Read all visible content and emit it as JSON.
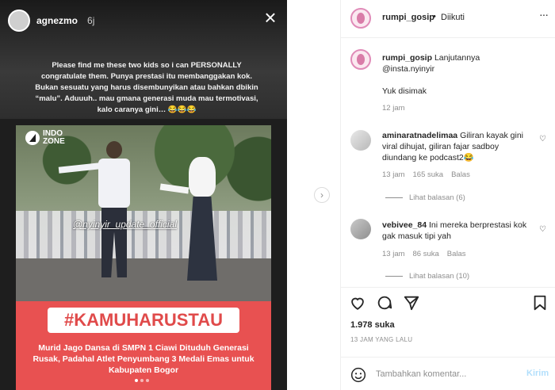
{
  "story": {
    "username": "agnezmo",
    "time": "6j",
    "caption": "Please find me these two kids so i can PERSONALLY congratulate them. Punya prestasi itu membanggakan kok. Bukan sesuatu yang harus disembunyikan atau bahkan dbikin “malu”. Aduuuh.. mau gmana generasi muda mau termotivasi, kalo caranya gini… 😂😂😂",
    "media_logo": "INDO ZONE",
    "watermark": "@nyinyir_update_official",
    "hashtag": "#KAMUHARUSTAU",
    "banner_text": "Murid Jago Dansa di SMPN 1 Ciawi Dituduh Generasi Rusak, Padahal Atlet Penyumbang 3 Medali Emas untuk Kabupaten Bogor",
    "close_icon": "×",
    "next_icon": "›"
  },
  "post": {
    "header": {
      "username": "rumpi_gosip",
      "dot": "•",
      "follow_status": "Diikuti",
      "more_icon": "···"
    },
    "caption": {
      "username": "rumpi_gosip",
      "text": "Lanjutannya",
      "mention": "@insta.nyinyir",
      "text2": "Yuk disimak",
      "time": "12 jam"
    },
    "comments": [
      {
        "username": "aminaratnadelimaa",
        "text": "Giliran kayak gini viral dihujat, giliran fajar sadboy diundang ke podcast2😂",
        "time": "13 jam",
        "likes": "165 suka",
        "reply": "Balas",
        "replies": "Lihat balasan (6)"
      },
      {
        "username": "vebivee_84",
        "text": "Ini mereka berprestasi kok gak masuk tipi yah",
        "time": "13 jam",
        "likes": "86 suka",
        "reply": "Balas",
        "replies": "Lihat balasan (10)"
      }
    ],
    "likes": "1.978 suka",
    "posted_ago": "13 JAM YANG LALU",
    "comment_placeholder": "Tambahkan komentar...",
    "send_label": "Kirim"
  }
}
